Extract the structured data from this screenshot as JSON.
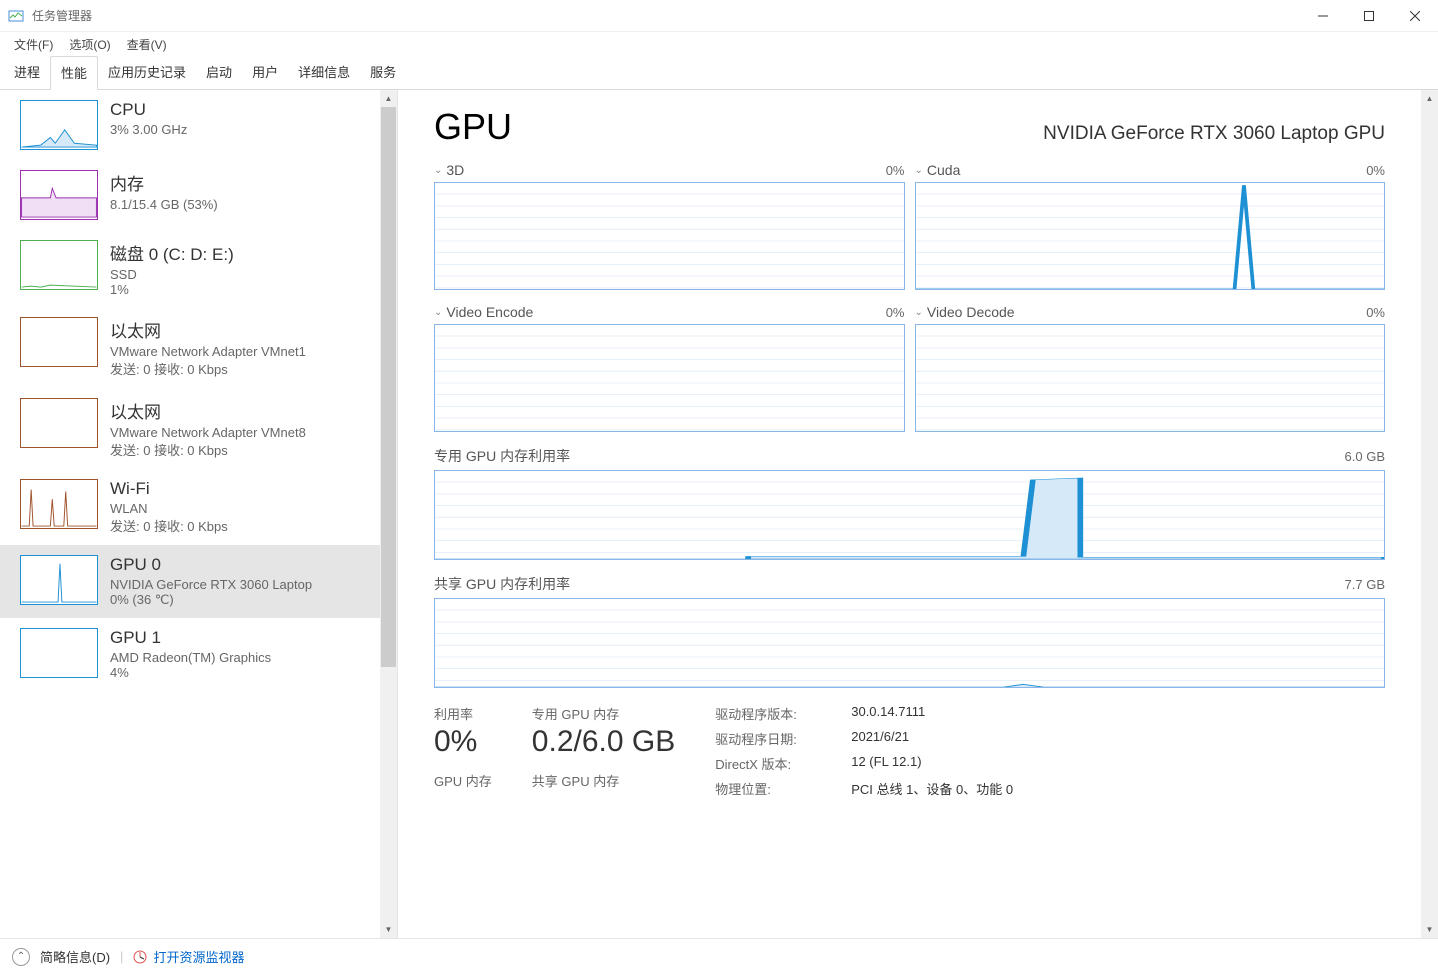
{
  "window": {
    "title": "任务管理器"
  },
  "menubar": [
    "文件(F)",
    "选项(O)",
    "查看(V)"
  ],
  "tabs": [
    "进程",
    "性能",
    "应用历史记录",
    "启动",
    "用户",
    "详细信息",
    "服务"
  ],
  "activeTab": 1,
  "sidebar": [
    {
      "title": "CPU",
      "line1": "3%  3.00 GHz",
      "line2": "",
      "color": "#1e90d4",
      "selected": false,
      "spark": "cpu"
    },
    {
      "title": "内存",
      "line1": "8.1/15.4 GB (53%)",
      "line2": "",
      "color": "#9b2fae",
      "selected": false,
      "spark": "mem"
    },
    {
      "title": "磁盘 0 (C: D: E:)",
      "line1": "SSD",
      "line2": "1%",
      "color": "#4caf50",
      "selected": false,
      "spark": "disk"
    },
    {
      "title": "以太网",
      "line1": "VMware Network Adapter VMnet1",
      "line2": "发送: 0 接收: 0 Kbps",
      "color": "#a0522d",
      "selected": false,
      "spark": "flat"
    },
    {
      "title": "以太网",
      "line1": "VMware Network Adapter VMnet8",
      "line2": "发送: 0 接收: 0 Kbps",
      "color": "#a0522d",
      "selected": false,
      "spark": "flat"
    },
    {
      "title": "Wi-Fi",
      "line1": "WLAN",
      "line2": "发送: 0 接收: 0 Kbps",
      "color": "#a0522d",
      "selected": false,
      "spark": "wifi"
    },
    {
      "title": "GPU 0",
      "line1": "NVIDIA GeForce RTX 3060 Laptop",
      "line2": "0%  (36 ℃)",
      "color": "#1e90d4",
      "selected": true,
      "spark": "gpu0"
    },
    {
      "title": "GPU 1",
      "line1": "AMD Radeon(TM) Graphics",
      "line2": "4%",
      "color": "#1e90d4",
      "selected": false,
      "spark": "flat"
    }
  ],
  "detail": {
    "heading": "GPU",
    "subheading": "NVIDIA GeForce RTX 3060 Laptop GPU",
    "charts_small": [
      {
        "label": "3D",
        "value": "0%"
      },
      {
        "label": "Cuda",
        "value": "0%"
      },
      {
        "label": "Video Encode",
        "value": "0%"
      },
      {
        "label": "Video Decode",
        "value": "0%"
      }
    ],
    "charts_wide": [
      {
        "label": "专用 GPU 内存利用率",
        "value": "6.0 GB",
        "spark": "dedicated"
      },
      {
        "label": "共享 GPU 内存利用率",
        "value": "7.7 GB",
        "spark": "shared"
      }
    ],
    "stats_left": [
      {
        "label": "利用率",
        "big": "0%"
      },
      {
        "label": "GPU 内存",
        "big": ""
      }
    ],
    "stats_mid": [
      {
        "label": "专用 GPU 内存",
        "big": "0.2/6.0 GB"
      },
      {
        "label": "共享 GPU 内存",
        "big": ""
      }
    ],
    "stats_right": [
      {
        "k": "驱动程序版本:",
        "v": "30.0.14.7111"
      },
      {
        "k": "驱动程序日期:",
        "v": "2021/6/21"
      },
      {
        "k": "DirectX 版本:",
        "v": "12 (FL 12.1)"
      },
      {
        "k": "物理位置:",
        "v": "PCI 总线 1、设备 0、功能 0"
      }
    ]
  },
  "statusbar": {
    "fewer": "简略信息(D)",
    "link": "打开资源监视器"
  },
  "chart_data": {
    "type": "line",
    "note": "Small GPU utilization panes are near 0%. Cuda shows a single spike to ~100% near the right edge. Dedicated GPU memory rises to ~5.5/6.0 GB for a short window then drops. Shared memory has a tiny blip near the right.",
    "series": [
      {
        "name": "3D",
        "unit": "%",
        "ylim": [
          0,
          100
        ],
        "values": [
          0
        ]
      },
      {
        "name": "Cuda",
        "unit": "%",
        "ylim": [
          0,
          100
        ],
        "values": [
          0,
          0,
          0,
          0,
          0,
          0,
          0,
          0,
          100,
          0
        ]
      },
      {
        "name": "Video Encode",
        "unit": "%",
        "ylim": [
          0,
          100
        ],
        "values": [
          0
        ]
      },
      {
        "name": "Video Decode",
        "unit": "%",
        "ylim": [
          0,
          100
        ],
        "values": [
          0
        ]
      },
      {
        "name": "Dedicated GPU Memory",
        "unit": "GB",
        "ylim": [
          0,
          6.0
        ],
        "values": [
          0,
          0,
          0,
          0.1,
          0.1,
          0.1,
          5.5,
          5.5,
          0.1,
          0.1
        ]
      },
      {
        "name": "Shared GPU Memory",
        "unit": "GB",
        "ylim": [
          0,
          7.7
        ],
        "values": [
          0,
          0,
          0,
          0,
          0,
          0,
          0.1,
          0,
          0,
          0
        ]
      }
    ]
  }
}
